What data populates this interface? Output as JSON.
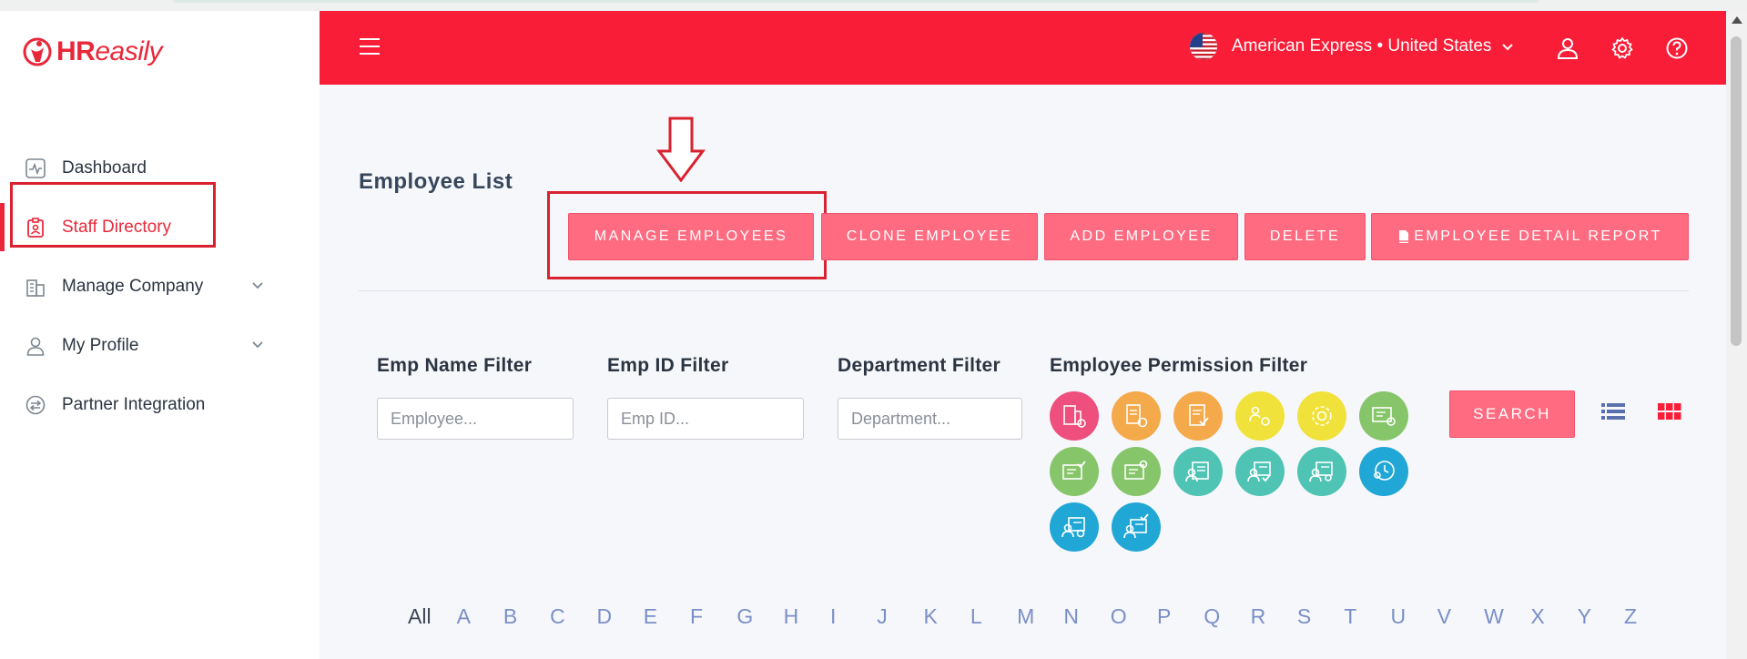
{
  "brand": {
    "name_bold": "HR",
    "name_light": "easily"
  },
  "sidebar": {
    "items": [
      {
        "label": "Dashboard",
        "icon": "activity-icon"
      },
      {
        "label": "Staff Directory",
        "icon": "id-badge-icon",
        "active": true
      },
      {
        "label": "Manage Company",
        "icon": "building-icon",
        "expandable": true
      },
      {
        "label": "My Profile",
        "icon": "user-icon",
        "expandable": true
      },
      {
        "label": "Partner Integration",
        "icon": "swap-icon"
      }
    ]
  },
  "header": {
    "company": "American Express • United States",
    "icons": [
      "user-icon",
      "gear-icon",
      "help-icon"
    ]
  },
  "main": {
    "title": "Employee List",
    "actions": [
      {
        "label": "MANAGE EMPLOYEES"
      },
      {
        "label": "CLONE EMPLOYEE"
      },
      {
        "label": "ADD EMPLOYEE"
      },
      {
        "label": "DELETE"
      },
      {
        "label": "EMPLOYEE DETAIL REPORT"
      }
    ],
    "filters": {
      "name": {
        "label": "Emp Name Filter",
        "placeholder": "Employee..."
      },
      "id": {
        "label": "Emp ID Filter",
        "placeholder": "Emp ID..."
      },
      "department": {
        "label": "Department Filter",
        "placeholder": "Department..."
      },
      "permission": {
        "label": "Employee Permission Filter"
      }
    },
    "search_label": "SEARCH",
    "alphabet": [
      "All",
      "A",
      "B",
      "C",
      "D",
      "E",
      "F",
      "G",
      "H",
      "I",
      "J",
      "K",
      "L",
      "M",
      "N",
      "O",
      "P",
      "Q",
      "R",
      "S",
      "T",
      "U",
      "V",
      "W",
      "X",
      "Y",
      "Z"
    ]
  },
  "colors": {
    "accent": "#f91d37",
    "button": "#ff6b81",
    "permission": [
      "#ee4f7d",
      "#f4a94a",
      "#f4a94a",
      "#f0e23a",
      "#f0e23a",
      "#86c56a",
      "#86c56a",
      "#86c56a",
      "#4fc4b4",
      "#4fc4b4",
      "#4fc4b4",
      "#21a7d6",
      "#21a7d6",
      "#21a7d6"
    ]
  }
}
